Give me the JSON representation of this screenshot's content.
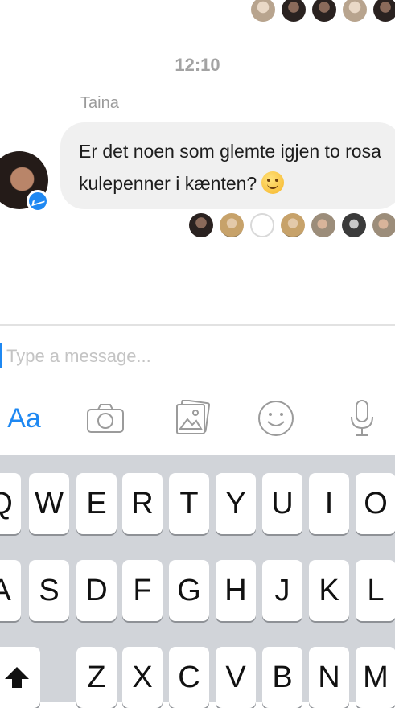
{
  "conversation": {
    "timestamp": "12:10",
    "sender": "Taina",
    "message": "Er det noen som glemte igjen to rosa kulepenner i kænten?",
    "top_seen_avatars": [
      "avatar-1",
      "avatar-2",
      "avatar-3",
      "avatar-4",
      "avatar-5"
    ],
    "read_receipts": [
      "avatar-1",
      "avatar-2",
      "avatar-3",
      "avatar-4",
      "avatar-5",
      "avatar-6",
      "avatar-7"
    ]
  },
  "composer": {
    "placeholder": "Type a message...",
    "value": ""
  },
  "toolbar": {
    "text_format_label": "Aa",
    "icons": [
      "camera-icon",
      "photo-gallery-icon",
      "emoji-icon",
      "microphone-icon"
    ]
  },
  "keyboard": {
    "row1": [
      "Q",
      "W",
      "E",
      "R",
      "T",
      "Y",
      "U",
      "I",
      "O"
    ],
    "row2": [
      "A",
      "S",
      "D",
      "F",
      "G",
      "H",
      "J",
      "K",
      "L"
    ],
    "row3": [
      "Z",
      "X",
      "C",
      "V",
      "B",
      "N",
      "M"
    ],
    "shift_icon": "shift-arrow-icon"
  },
  "colors": {
    "accent": "#1e88f2",
    "bubble": "#f0f0f0",
    "keyboard_bg": "#d1d4d9"
  }
}
